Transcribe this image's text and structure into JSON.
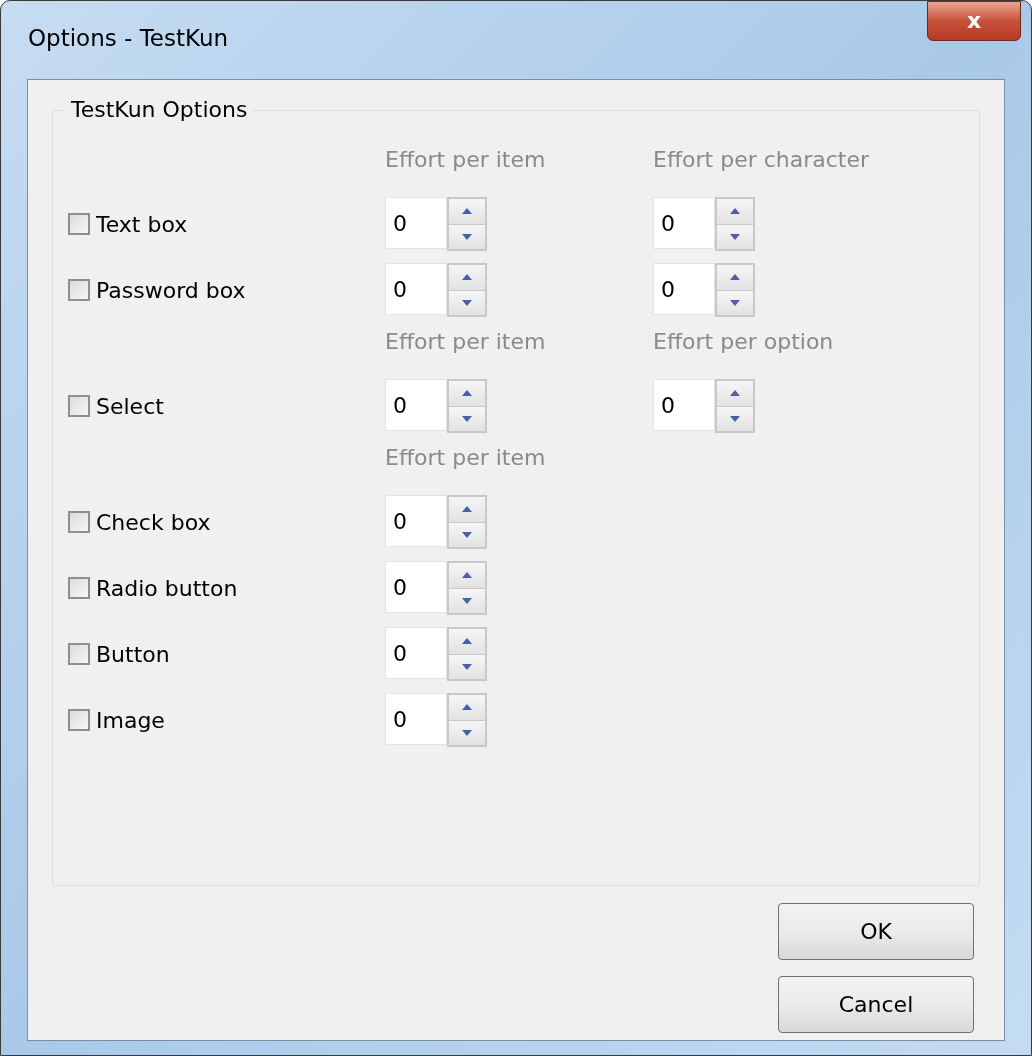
{
  "window": {
    "title": "Options - TestKun",
    "close_label": "x"
  },
  "group": {
    "title": "TestKun Options"
  },
  "sections": [
    {
      "headers": [
        "Effort per item",
        "Effort per character"
      ],
      "items": [
        {
          "label": "Text box",
          "checked": false,
          "values": [
            "0",
            "0"
          ]
        },
        {
          "label": "Password box",
          "checked": false,
          "values": [
            "0",
            "0"
          ]
        }
      ]
    },
    {
      "headers": [
        "Effort per item",
        "Effort per option"
      ],
      "items": [
        {
          "label": "Select",
          "checked": false,
          "values": [
            "0",
            "0"
          ]
        }
      ]
    },
    {
      "headers": [
        "Effort per item"
      ],
      "items": [
        {
          "label": "Check box",
          "checked": false,
          "values": [
            "0"
          ]
        },
        {
          "label": "Radio button",
          "checked": false,
          "values": [
            "0"
          ]
        },
        {
          "label": "Button",
          "checked": false,
          "values": [
            "0"
          ]
        },
        {
          "label": "Image",
          "checked": false,
          "values": [
            "0"
          ]
        }
      ]
    }
  ],
  "buttons": [
    "OK",
    "Cancel"
  ]
}
